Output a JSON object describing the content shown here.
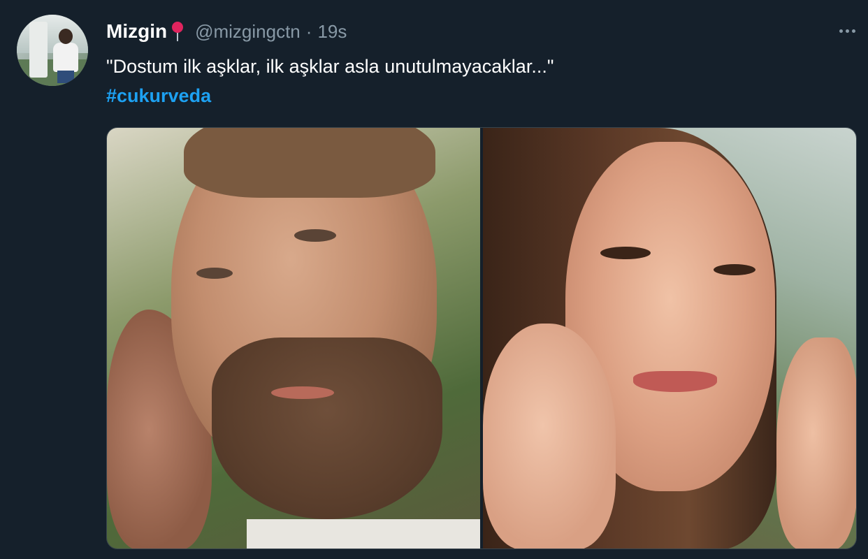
{
  "tweet": {
    "display_name": "Mizgin",
    "name_emoji": "round-pushpin",
    "handle": "@mizgingctn",
    "separator": "·",
    "time": "19s",
    "text": "\"Dostum ilk aşklar, ilk aşklar asla unutulmayacaklar...\"",
    "hashtag": "#cukurveda"
  },
  "icons": {
    "more": "more-horizontal-icon",
    "pin": "round-pushpin"
  },
  "colors": {
    "background": "#15202b",
    "text_primary": "#ffffff",
    "text_secondary": "#8899a6",
    "link": "#1da1f2",
    "pin": "#e0245e"
  }
}
